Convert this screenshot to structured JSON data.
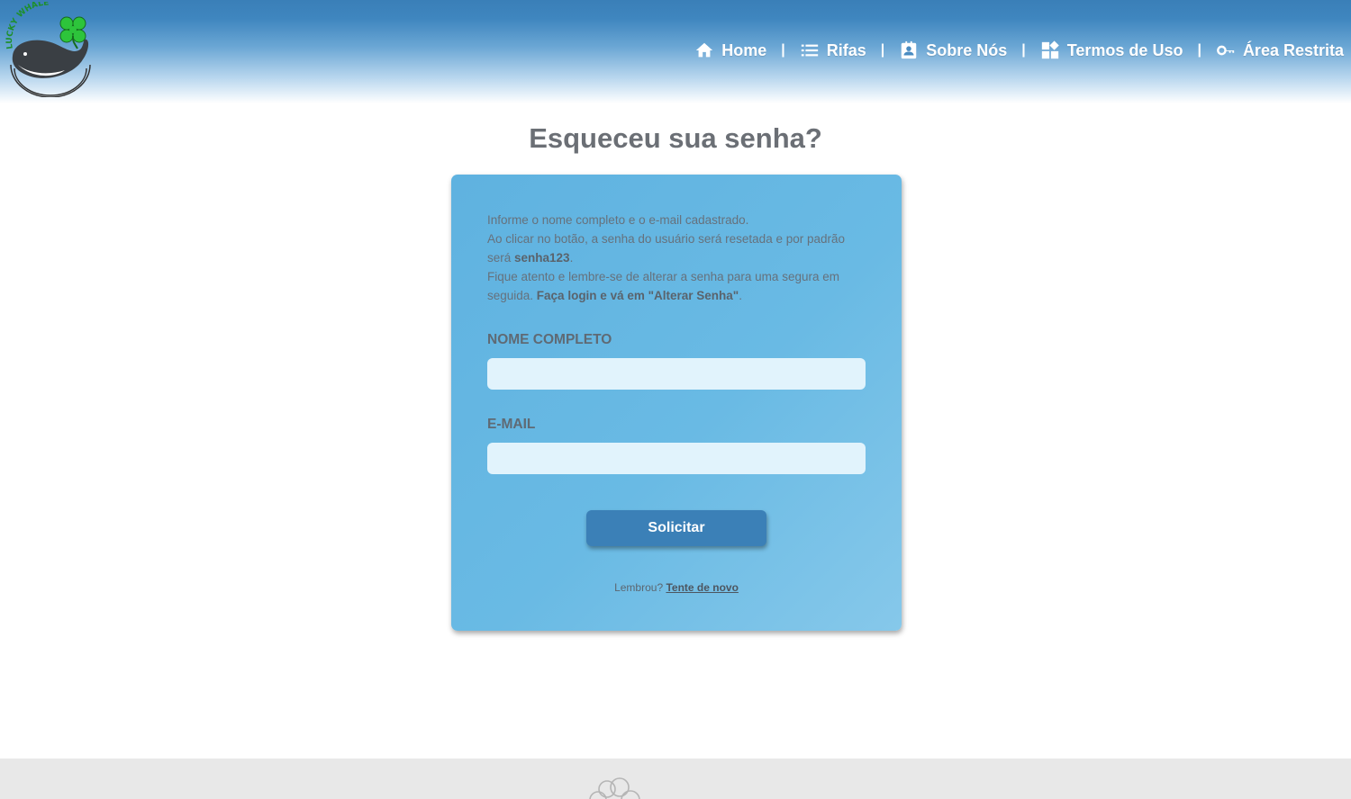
{
  "header": {
    "logo_text": "LUCKY WHALE",
    "nav": [
      {
        "icon": "home-icon",
        "label": "Home"
      },
      {
        "icon": "list-icon",
        "label": "Rifas"
      },
      {
        "icon": "contact-card-icon",
        "label": "Sobre Nós"
      },
      {
        "icon": "widgets-icon",
        "label": "Termos de Uso"
      },
      {
        "icon": "key-icon",
        "label": "Área Restrita"
      }
    ],
    "separator": "|"
  },
  "page": {
    "title": "Esqueceu sua senha?"
  },
  "form": {
    "info_line1": "Informe o nome completo e o e-mail cadastrado.",
    "info_line2a": "Ao clicar no botão, a senha do usuário será resetada e por padrão será ",
    "info_password": "senha123",
    "info_line2b": ".",
    "info_line3a": "Fique atento e lembre-se de alterar a senha para uma segura em seguida. ",
    "info_line3b": "Faça login e vá em \"Alterar Senha\"",
    "info_line3c": ".",
    "name_label": "NOME COMPLETO",
    "name_value": "",
    "email_label": "E-MAIL",
    "email_value": "",
    "submit_label": "Solicitar",
    "remember_text": "Lembrou? ",
    "retry_link": "Tente de novo"
  },
  "colors": {
    "header_blue": "#3a7fb8",
    "card_blue": "#69bae4",
    "button_blue": "#3b80b7",
    "input_bg": "#e1f3fc",
    "title_gray": "#6b6f75",
    "clover_green": "#2dc43b"
  }
}
